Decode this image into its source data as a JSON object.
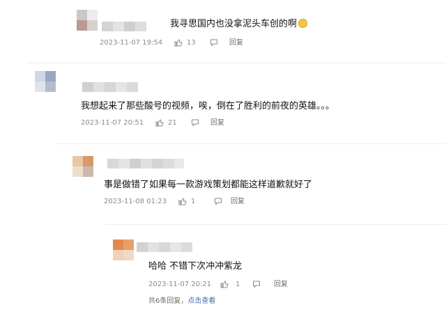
{
  "comments": [
    {
      "text": "我寻思国内也没拿泥头车创的啊",
      "emoji": "face-with-tears-emoji",
      "time": "2023-11-07 19:54",
      "likes": "13",
      "reply_label": "回复"
    },
    {
      "text": "我想起来了那些酸号的视频，唉，倒在了胜利的前夜的英雄。。。",
      "time": "2023-11-07 20:51",
      "likes": "21",
      "reply_label": "回复"
    },
    {
      "text": "事是做错了如果每一款游戏策划都能这样道歉就好了",
      "time": "2023-11-08 01:23",
      "likes": "1",
      "reply_label": "回复"
    },
    {
      "text": "哈哈   不错下次冲冲紫龙",
      "time": "2023-11-07 20:21",
      "likes": "1",
      "reply_label": "回复"
    }
  ],
  "replies_footer": {
    "count_text": "共6条回复，",
    "more_label": "点击查看"
  },
  "colors": {
    "text": "#111111",
    "meta": "#8a8a8a",
    "link": "#4a6ea9"
  }
}
